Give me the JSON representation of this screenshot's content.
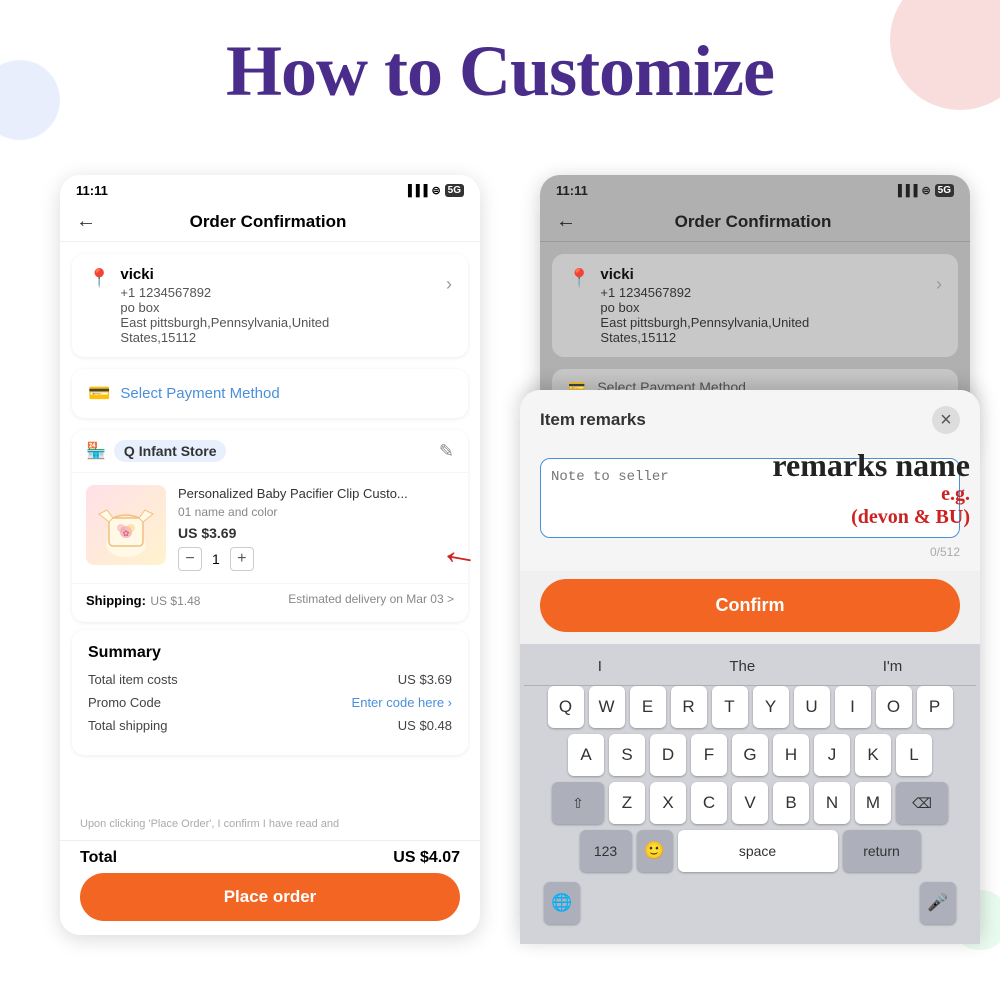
{
  "title": "How to Customize",
  "left_phone": {
    "status_time": "11:11",
    "status_signal": "▐▐▐",
    "status_wifi": "WiFi",
    "status_network": "5G",
    "nav_title": "Order Confirmation",
    "address": {
      "name": "vicki",
      "phone": "+1 1234567892",
      "po_box": "po box",
      "city_state": "East pittsburgh,Pennsylvania,United",
      "zip": "States,15112"
    },
    "payment_method": "Select Payment Method",
    "store_name": "Q  Infant Store",
    "product_name": "Personalized Baby Pacifier Clip Custo...",
    "product_variant": "01 name and color",
    "product_price": "US $3.69",
    "product_qty": "1",
    "shipping_label": "Shipping:",
    "shipping_cost": "US $1.48",
    "shipping_delivery": "Estimated delivery on Mar 03 >",
    "summary_title": "Summary",
    "summary_rows": [
      {
        "label": "Total item costs",
        "value": "US $3.69"
      },
      {
        "label": "Promo Code",
        "value": "Enter code here >"
      },
      {
        "label": "Total shipping",
        "value": "US $0.48"
      }
    ],
    "disclaimer": "Upon clicking 'Place Order', I confirm I have read and",
    "total_label": "Total",
    "total_value": "US $4.07",
    "place_order": "Place order"
  },
  "right_phone": {
    "status_time": "11:11",
    "nav_title": "Order Confirmation",
    "address": {
      "name": "vicki",
      "phone": "+1 1234567892",
      "po_box": "po box",
      "city_state": "East pittsburgh,Pennsylvania,United",
      "zip": "States,15112"
    },
    "payment_label": "Select Payment Method"
  },
  "modal": {
    "title": "Item remarks",
    "close": "×",
    "placeholder": "Note to seller",
    "char_count": "0/512",
    "confirm_label": "Confirm"
  },
  "annotation": {
    "remarks_name": "remarks name",
    "eg_label": "e.g.",
    "eg_example": "(devon & BU)"
  },
  "keyboard": {
    "suggestions": [
      "I",
      "The",
      "I'm"
    ],
    "row1": [
      "Q",
      "W",
      "E",
      "R",
      "T",
      "Y",
      "U",
      "I",
      "O",
      "P"
    ],
    "row2": [
      "A",
      "S",
      "D",
      "F",
      "G",
      "H",
      "J",
      "K",
      "L"
    ],
    "row3": [
      "Z",
      "X",
      "C",
      "V",
      "B",
      "N",
      "M"
    ],
    "bottom_left": "123",
    "space": "space",
    "return": "return"
  }
}
